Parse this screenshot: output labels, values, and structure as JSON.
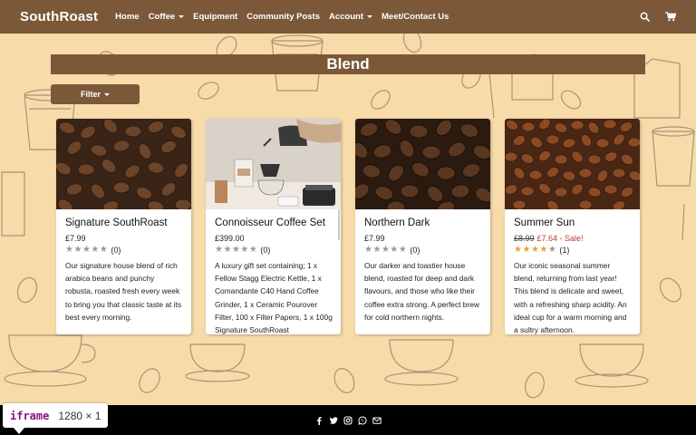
{
  "navbar": {
    "brand": "SouthRoast",
    "items": [
      {
        "label": "Home",
        "dropdown": false
      },
      {
        "label": "Coffee",
        "dropdown": true
      },
      {
        "label": "Equipment",
        "dropdown": false
      },
      {
        "label": "Community Posts",
        "dropdown": false
      },
      {
        "label": "Account",
        "dropdown": true
      },
      {
        "label": "Meet/Contact Us",
        "dropdown": false
      }
    ],
    "icons": [
      "search-icon",
      "cart-icon"
    ]
  },
  "page": {
    "heading": "Blend",
    "filter_label": "Filter"
  },
  "products": [
    {
      "title": "Signature SouthRoast",
      "price": "£7.99",
      "old_price": "",
      "sale_price": "",
      "rating": 0,
      "rating_count": "(0)",
      "description": "Our signature house blend of rich arabica beans and punchy robusta, roasted fresh every week to bring you that classic taste at its best every morning."
    },
    {
      "title": "Connoisseur Coffee Set",
      "price": "£399.00",
      "old_price": "",
      "sale_price": "",
      "rating": 0,
      "rating_count": "(0)",
      "description": "A luxury gift set containing; 1 x Fellow Stagg Electric Kettle, 1 x Comandante C40 Hand Coffee Grinder, 1 x Ceramic Pourover Filter, 100 x Filter Papers, 1 x 100g Signature SouthRoast"
    },
    {
      "title": "Northern Dark",
      "price": "£7.99",
      "old_price": "",
      "sale_price": "",
      "rating": 0,
      "rating_count": "(0)",
      "description": "Our darker and toastier house blend, roasted for deep and dark flavours, and those who like their coffee extra strong. A perfect brew for cold northern nights."
    },
    {
      "title": "Summer Sun",
      "price": "",
      "old_price": "£8.99",
      "sale_price": "£7.64 - Sale!",
      "rating": 4,
      "rating_count": "(1)",
      "description": "Our iconic seasonal summer blend, returning from last year! This blend is delicate and sweet, with a refreshing sharp acidity. An ideal cup for a warm morning and a sultry afternoon."
    }
  ],
  "footer": {
    "icons": [
      "facebook-icon",
      "twitter-icon",
      "instagram-icon",
      "whatsapp-icon",
      "email-icon"
    ]
  },
  "devtools_badge": {
    "tag": "iframe",
    "dims": "1280 × 1"
  },
  "colors": {
    "brown": "#7a5838",
    "background": "#f7dcaa",
    "sale_red": "#c0392b",
    "star_gold": "#e6a23c",
    "footer": "#000000"
  }
}
